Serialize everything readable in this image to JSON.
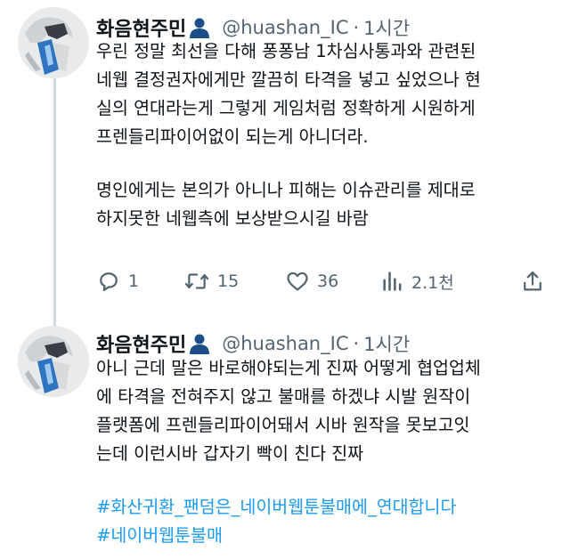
{
  "tweets": [
    {
      "author": {
        "display_name": "화음현주민",
        "badge_icon": "person-icon",
        "handle": "@huashan_IC",
        "separator": "·",
        "time": "1시간"
      },
      "lines": [
        "우린 정말 최선을 다해 퐁퐁남 1차심사통과와 관련된",
        "네웹 결정권자에게만 깔끔히 타격을 넣고 싶었으나 현",
        "실의 연대라는게 그렇게 게임처럼 정확하게 시원하게",
        "프렌들리파이어없이 되는게 아니더라.",
        "",
        "명인에게는 본의가 아니나 피해는 이슈관리를 제대로",
        "하지못한 네웹측에 보상받으시길 바람"
      ],
      "stats": {
        "replies": "1",
        "retweets": "15",
        "likes": "36",
        "views": "2.1천"
      }
    },
    {
      "author": {
        "display_name": "화음현주민",
        "badge_icon": "person-icon",
        "handle": "@huashan_IC",
        "separator": "·",
        "time": "1시간"
      },
      "lines": [
        "아니 근데 말은 바로해야되는게 진짜 어떻게 협업업체",
        "에 타격을 전혀주지 않고 불매를 하겠냐 시발 원작이",
        "플랫폼에 프렌들리파이어돼서 시바 원작을 못보고잇",
        "는데 이런시바 갑자기 빡이 친다 진짜"
      ],
      "hashtags": [
        "#화산귀환_팬덤은_네이버웹툰불매에_연대합니다",
        "#네이버웹툰불매"
      ]
    }
  ],
  "colors": {
    "text": "#0f1419",
    "secondary": "#536471",
    "link": "#1d9bf0",
    "badge": "#1d4e89"
  }
}
